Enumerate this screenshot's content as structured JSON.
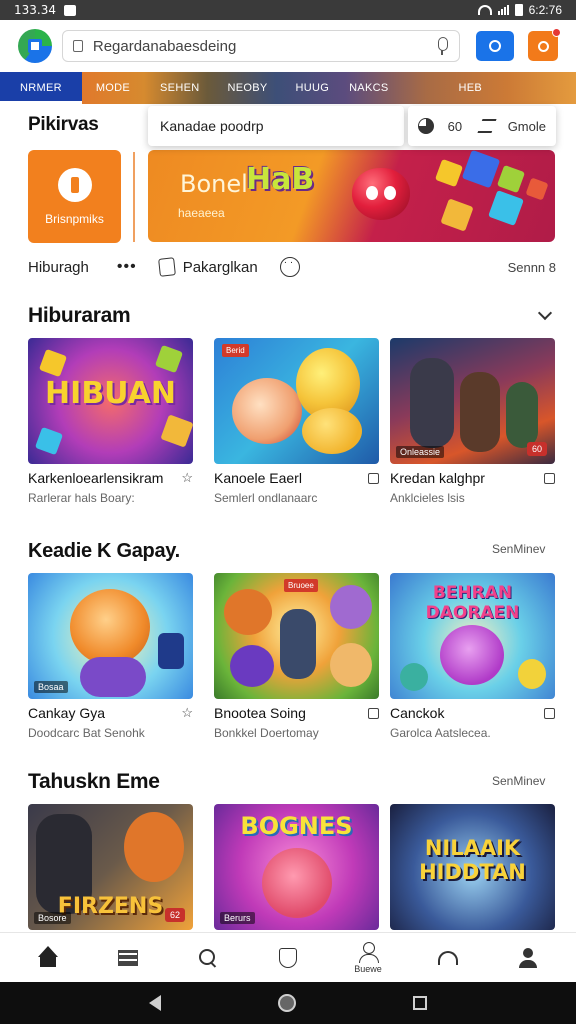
{
  "status": {
    "time": "133.34",
    "right_time": "6:2:76"
  },
  "search": {
    "value": "Regardanabaesdeing"
  },
  "categories": [
    "NRMER",
    "MODE",
    "SEHEN",
    "NEOBY",
    "HUUG",
    "NAKCS",
    "HEB"
  ],
  "suggestion": {
    "text": "Kanadae poodrp",
    "num": "60",
    "label": "Gmole"
  },
  "hero": {
    "title": "Pikirvas",
    "tile_label": "Brisnpmiks",
    "banner_text1": "Bonel",
    "banner_text2": "HaB",
    "banner_sub": "haeaeea"
  },
  "actions": {
    "left": "Hiburagh",
    "dots": "•••",
    "middle": "Pakarglkan",
    "right": "Sennn 8"
  },
  "sections": [
    {
      "title": "Hiburaram",
      "cards": [
        {
          "title": "Karkenloearlensikram",
          "sub": "Rarlerar hals Boary:",
          "thumb_text": "HIBUAN"
        },
        {
          "title": "Kanoele Eaerl",
          "sub": "Semlerl ondlanaarc",
          "tag": "Berid"
        },
        {
          "title": "Kredan kalghpr",
          "sub": "Anklcieles lsis",
          "badge": "Onleassie",
          "rtag": "60"
        }
      ]
    },
    {
      "title": "Keadie K Gapay.",
      "see_more": "SenMinev",
      "cards": [
        {
          "title": "Cankay Gya",
          "sub": "Doodcarc Bat Senohk",
          "badge": "Bosaa"
        },
        {
          "title": "Bnootea Soing",
          "sub": "Bonkkel Doertomay",
          "tag": "Bruoee"
        },
        {
          "title": "Canckok",
          "sub": "Garolca Aatslecea.",
          "thumb_text": "BEHRAN DAORAEN"
        }
      ]
    },
    {
      "title": "Tahuskn Eme",
      "see_more": "SenMinev",
      "cards": [
        {
          "title": "",
          "sub": "",
          "badge": "Bosore",
          "thumb_text": "FIRZENS",
          "rtag": "62"
        },
        {
          "title": "",
          "sub": "",
          "badge": "Berurs",
          "thumb_text": "BOGNES"
        },
        {
          "title": "",
          "sub": "",
          "thumb_text": "NILAAIK HIDDTAN"
        }
      ]
    }
  ],
  "bottom_nav": {
    "highlight_label": "Buewe"
  },
  "colors": {
    "accent_blue": "#1a73e8",
    "accent_orange": "#f27a1a"
  }
}
